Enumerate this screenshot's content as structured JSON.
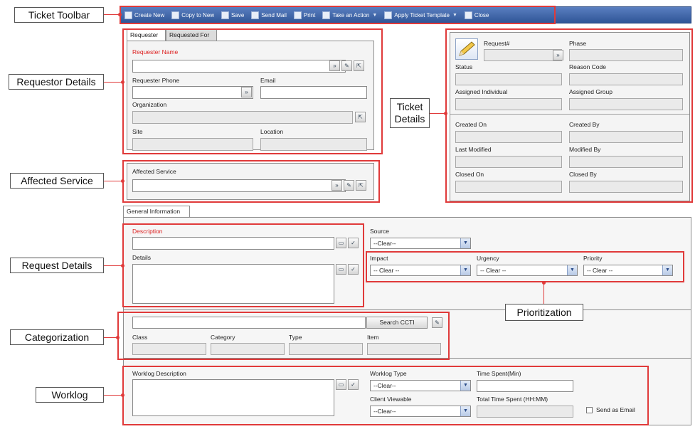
{
  "callouts": {
    "toolbar": "Ticket Toolbar",
    "requestor": "Requestor Details",
    "affected": "Affected Service",
    "request": "Request Details",
    "categorization": "Categorization",
    "worklog": "Worklog",
    "ticket_line1": "Ticket",
    "ticket_line2": "Details",
    "prioritization": "Prioritization"
  },
  "toolbar": {
    "create_new": "Create New",
    "copy_to_new": "Copy to New",
    "save": "Save",
    "send_mail": "Send Mail",
    "print": "Print",
    "take_action": "Take an Action",
    "apply_template": "Apply Ticket Template",
    "close": "Close"
  },
  "requester": {
    "tab_requester": "Requester",
    "tab_requested_for": "Requested For",
    "name_label": "Requester Name",
    "phone_label": "Requester Phone",
    "email_label": "Email",
    "organization_label": "Organization",
    "site_label": "Site",
    "location_label": "Location"
  },
  "affected_service": {
    "label": "Affected Service"
  },
  "ticket": {
    "request_label": "Request#",
    "phase_label": "Phase",
    "status_label": "Status",
    "reason_label": "Reason Code",
    "assigned_individual_label": "Assigned Individual",
    "assigned_group_label": "Assigned Group",
    "created_on_label": "Created On",
    "created_by_label": "Created By",
    "last_modified_label": "Last Modified",
    "modified_by_label": "Modified By",
    "closed_on_label": "Closed On",
    "closed_by_label": "Closed By"
  },
  "general": {
    "tab": "General Information",
    "description_label": "Description",
    "details_label": "Details",
    "source_label": "Source",
    "source_value": "--Clear--",
    "impact_label": "Impact",
    "impact_value": "-- Clear --",
    "urgency_label": "Urgency",
    "urgency_value": "-- Clear --",
    "priority_label": "Priority",
    "priority_value": "-- Clear --"
  },
  "categorization": {
    "search_button": "Search CCTI",
    "class_label": "Class",
    "category_label": "Category",
    "type_label": "Type",
    "item_label": "Item"
  },
  "worklog": {
    "description_label": "Worklog Description",
    "type_label": "Worklog Type",
    "type_value": "--Clear--",
    "time_spent_label": "Time Spent(Min)",
    "client_viewable_label": "Client Viewable",
    "client_viewable_value": "--Clear--",
    "total_time_label": "Total Time Spent (HH:MM)",
    "send_email_label": "Send as Email"
  }
}
